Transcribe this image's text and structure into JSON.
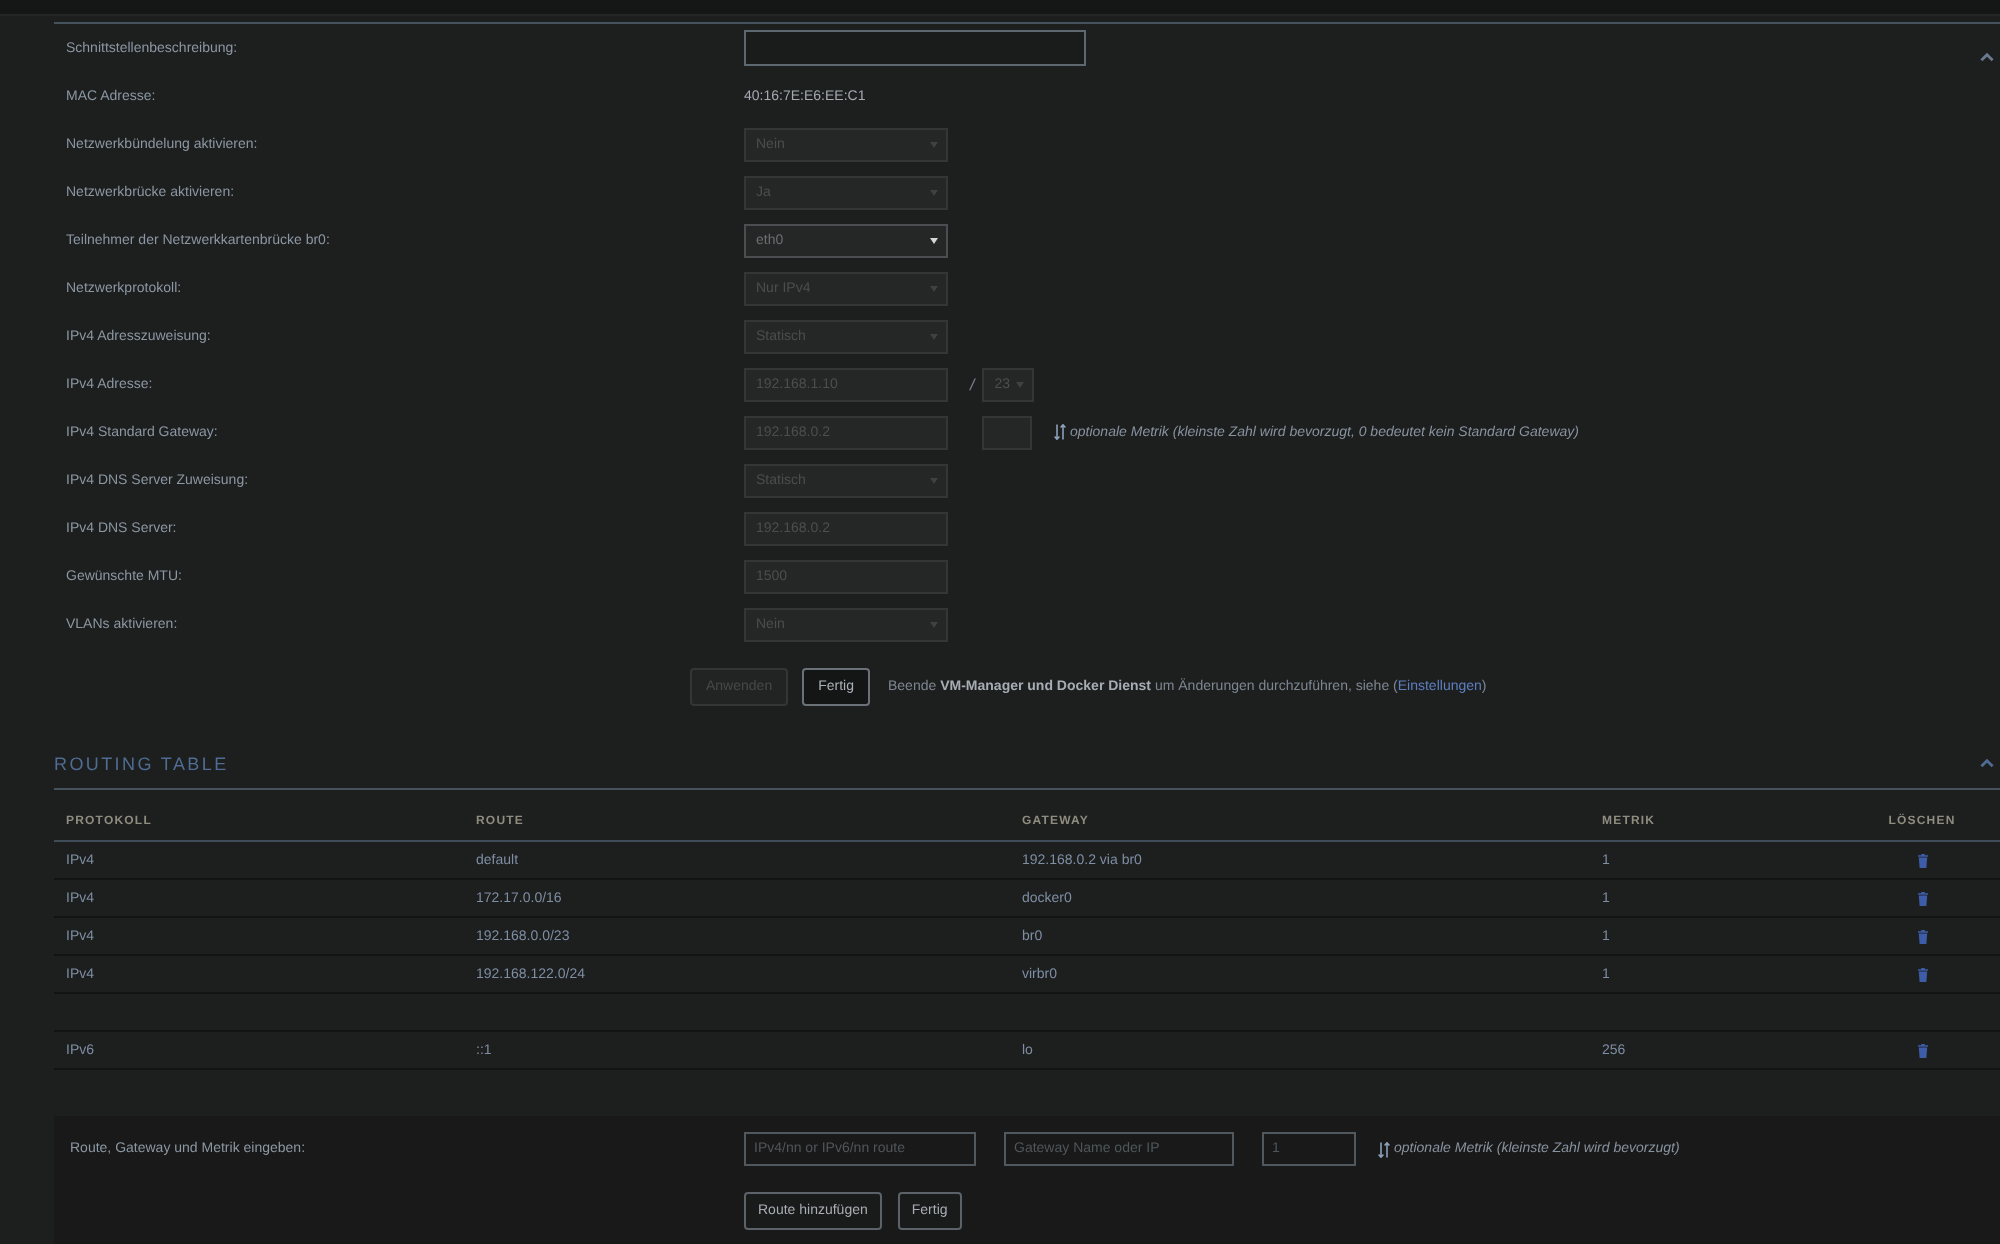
{
  "settings_section": {
    "expanded": true,
    "rows": [
      {
        "label": "Schnittstellenbeschreibung:",
        "controls": [
          {
            "kind": "wide_input",
            "disabled": false
          }
        ]
      },
      {
        "label": "MAC Adresse:",
        "controls": [
          {
            "kind": "text",
            "text": "40:16:7E:E6:EE:C1"
          }
        ]
      },
      {
        "label": "Netzwerkbündelung aktivieren:",
        "controls": [
          {
            "kind": "select",
            "value": "Nein",
            "disabled": true
          }
        ]
      },
      {
        "label": "Netzwerkbrücke aktivieren:",
        "controls": [
          {
            "kind": "select",
            "value": "Ja",
            "disabled": true
          }
        ]
      },
      {
        "label": "Teilnehmer der Netzwerkkartenbrücke br0:",
        "controls": [
          {
            "kind": "select",
            "value": "eth0",
            "disabled": false
          }
        ]
      },
      {
        "label": "Netzwerkprotokoll:",
        "controls": [
          {
            "kind": "select",
            "value": "Nur IPv4",
            "disabled": true
          }
        ]
      },
      {
        "label": "IPv4 Adresszuweisung:",
        "controls": [
          {
            "kind": "select",
            "value": "Statisch",
            "disabled": true
          }
        ]
      },
      {
        "label": "IPv4 Adresse:",
        "controls": [
          {
            "kind": "input",
            "value": "192.168.1.10",
            "disabled": true
          },
          {
            "kind": "separator",
            "text": "/"
          },
          {
            "kind": "small_select",
            "value": "23",
            "disabled": true
          }
        ]
      },
      {
        "label": "IPv4 Standard Gateway:",
        "controls": [
          {
            "kind": "input",
            "value": "192.168.0.2",
            "disabled": true
          },
          {
            "kind": "small_input",
            "disabled": true
          },
          {
            "kind": "hint",
            "text": "optionale Metrik (kleinste Zahl wird bevorzugt, 0 bedeutet kein Standard Gateway)"
          }
        ]
      },
      {
        "label": "IPv4 DNS Server Zuweisung:",
        "controls": [
          {
            "kind": "select",
            "value": "Statisch",
            "disabled": true
          }
        ]
      },
      {
        "label": "IPv4 DNS Server:",
        "controls": [
          {
            "kind": "input",
            "value": "192.168.0.2",
            "disabled": true
          }
        ]
      },
      {
        "label": "Gewünschte MTU:",
        "controls": [
          {
            "kind": "input",
            "value": "1500",
            "disabled": true
          }
        ]
      },
      {
        "label": "VLANs aktivieren:",
        "controls": [
          {
            "kind": "select",
            "value": "Nein",
            "disabled": true
          }
        ]
      }
    ],
    "buttons": [
      {
        "label": "Anwenden",
        "disabled": true
      },
      {
        "label": "Fertig",
        "disabled": false
      }
    ],
    "note": {
      "text": "Beende **VM-Manager und Docker Dienst** um Änderungen durchzuführen, siehe (",
      "link": "Einstellungen",
      "text_after": ")"
    }
  },
  "routing_table": {
    "title": "ROUTING TABLE",
    "expanded": true,
    "columns": [
      "PROTOKOLL",
      "ROUTE",
      "GATEWAY",
      "METRIK",
      "LÖSCHEN"
    ],
    "rows": [
      {
        "kind": "route",
        "protocol": "IPv4",
        "route": "default",
        "gateway": "192.168.0.2 via br0",
        "metric": "1"
      },
      {
        "kind": "route",
        "protocol": "IPv4",
        "route": "172.17.0.0/16",
        "gateway": "docker0",
        "metric": "1"
      },
      {
        "kind": "route",
        "protocol": "IPv4",
        "route": "192.168.0.0/23",
        "gateway": "br0",
        "metric": "1"
      },
      {
        "kind": "route",
        "protocol": "IPv4",
        "route": "192.168.122.0/24",
        "gateway": "virbr0",
        "metric": "1"
      },
      {
        "kind": "spacer"
      },
      {
        "kind": "route",
        "protocol": "IPv6",
        "route": "::1",
        "gateway": "lo",
        "metric": "256"
      }
    ]
  },
  "add_route": {
    "label": "Route, Gateway und Metrik eingeben:",
    "fields": [
      {
        "placeholder": "IPv4/nn or IPv6/nn route"
      },
      {
        "placeholder": "Gateway Name oder IP"
      },
      {
        "placeholder": "1"
      }
    ],
    "hint": "optionale Metrik (kleinste Zahl wird bevorzugt)",
    "buttons": [
      "Route hinzufügen",
      "Fertig"
    ]
  }
}
